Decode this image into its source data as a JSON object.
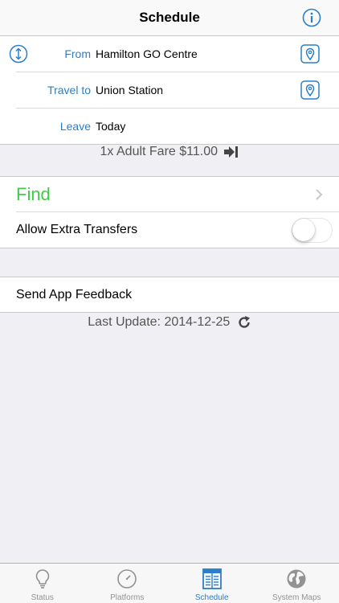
{
  "nav": {
    "title": "Schedule",
    "info_icon": "info-icon"
  },
  "form": {
    "from": {
      "label": "From",
      "value": "Hamilton GO Centre"
    },
    "travel_to": {
      "label": "Travel to",
      "value": "Union Station"
    },
    "leave": {
      "label": "Leave",
      "value": "Today"
    }
  },
  "fare": {
    "text": "1x Adult Fare $11.00",
    "icon": "arrow-right-icon"
  },
  "actions": {
    "find_label": "Find",
    "extra_transfers_label": "Allow Extra Transfers",
    "extra_transfers_on": false,
    "feedback_label": "Send App Feedback"
  },
  "update": {
    "text": "Last Update: 2014-12-25",
    "icon": "refresh-icon"
  },
  "tabs": [
    {
      "label": "Status",
      "icon": "lightbulb-icon",
      "active": false
    },
    {
      "label": "Platforms",
      "icon": "compass-icon",
      "active": false
    },
    {
      "label": "Schedule",
      "icon": "schedule-icon",
      "active": true
    },
    {
      "label": "System Maps",
      "icon": "globe-icon",
      "active": false
    }
  ],
  "colors": {
    "accent": "#2b7ec9",
    "find": "#3ecc47",
    "background": "#efeff4"
  }
}
